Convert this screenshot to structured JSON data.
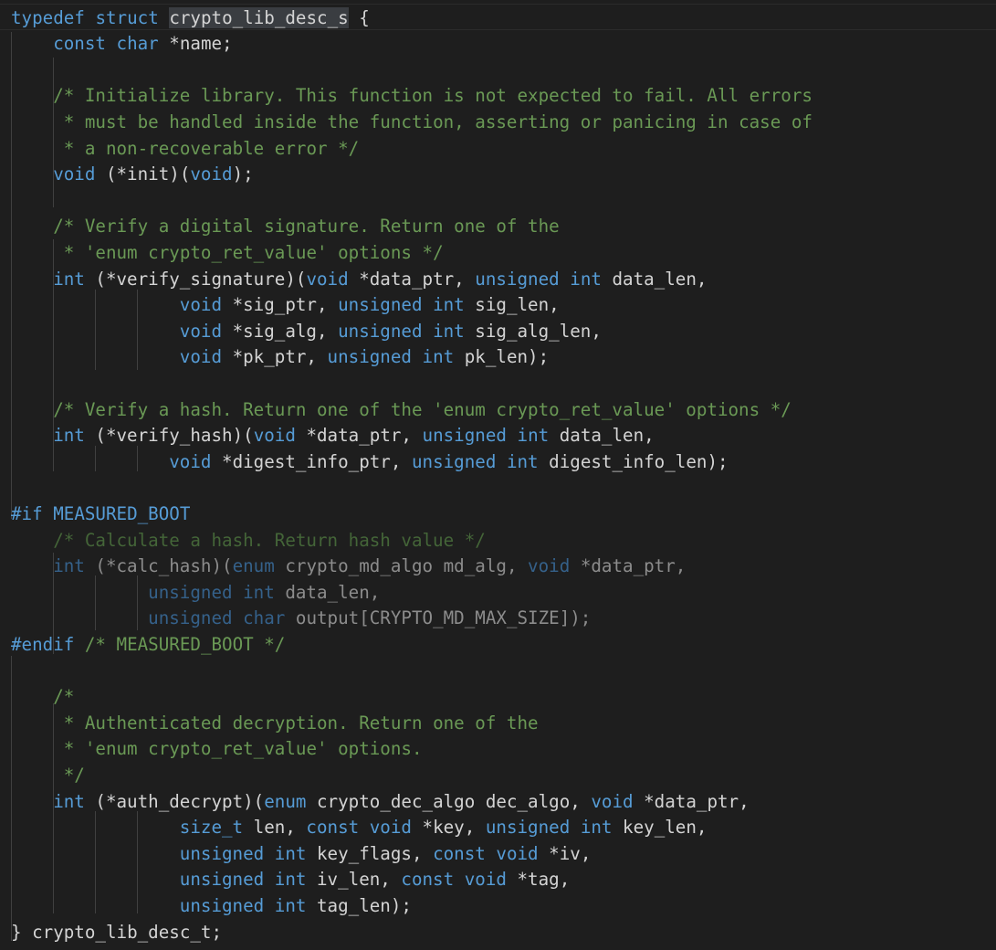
{
  "editor": {
    "colors": {
      "background": "#1e1e1e",
      "keyword": "#569cd6",
      "comment": "#6a9955",
      "text": "#d4d4d4",
      "selection": "#3a3d41",
      "indent_guide": "#404040"
    },
    "lines": [
      {
        "row": 0,
        "indent": 0,
        "dim": false,
        "tokens": [
          [
            "kw",
            "typedef"
          ],
          [
            "tx",
            " "
          ],
          [
            "kw",
            "struct"
          ],
          [
            "tx",
            " "
          ],
          [
            "hl",
            "crypto_lib_desc_s"
          ],
          [
            "tx",
            " {"
          ]
        ]
      },
      {
        "row": 1,
        "indent": 4,
        "dim": false,
        "tokens": [
          [
            "kw",
            "const"
          ],
          [
            "tx",
            " "
          ],
          [
            "kw",
            "char"
          ],
          [
            "tx",
            " *name;"
          ]
        ]
      },
      {
        "row": 3,
        "indent": 4,
        "dim": false,
        "tokens": [
          [
            "cm",
            "/* Initialize library. This function is not expected to fail. All errors"
          ]
        ]
      },
      {
        "row": 4,
        "indent": 5,
        "dim": false,
        "tokens": [
          [
            "cm",
            "* must be handled inside the function, asserting or panicing in case of"
          ]
        ]
      },
      {
        "row": 5,
        "indent": 5,
        "dim": false,
        "tokens": [
          [
            "cm",
            "* a non-recoverable error */"
          ]
        ]
      },
      {
        "row": 6,
        "indent": 4,
        "dim": false,
        "tokens": [
          [
            "kw",
            "void"
          ],
          [
            "tx",
            " (*init)("
          ],
          [
            "kw",
            "void"
          ],
          [
            "tx",
            ");"
          ]
        ]
      },
      {
        "row": 8,
        "indent": 4,
        "dim": false,
        "tokens": [
          [
            "cm",
            "/* Verify a digital signature. Return one of the"
          ]
        ]
      },
      {
        "row": 9,
        "indent": 5,
        "dim": false,
        "tokens": [
          [
            "cm",
            "* 'enum crypto_ret_value' options */"
          ]
        ]
      },
      {
        "row": 10,
        "indent": 4,
        "dim": false,
        "tokens": [
          [
            "kw",
            "int"
          ],
          [
            "tx",
            " (*verify_signature)("
          ],
          [
            "kw",
            "void"
          ],
          [
            "tx",
            " *data_ptr, "
          ],
          [
            "kw",
            "unsigned"
          ],
          [
            "tx",
            " "
          ],
          [
            "kw",
            "int"
          ],
          [
            "tx",
            " data_len,"
          ]
        ]
      },
      {
        "row": 11,
        "indent": 16,
        "dim": false,
        "tokens": [
          [
            "kw",
            "void"
          ],
          [
            "tx",
            " *sig_ptr, "
          ],
          [
            "kw",
            "unsigned"
          ],
          [
            "tx",
            " "
          ],
          [
            "kw",
            "int"
          ],
          [
            "tx",
            " sig_len,"
          ]
        ]
      },
      {
        "row": 12,
        "indent": 16,
        "dim": false,
        "tokens": [
          [
            "kw",
            "void"
          ],
          [
            "tx",
            " *sig_alg, "
          ],
          [
            "kw",
            "unsigned"
          ],
          [
            "tx",
            " "
          ],
          [
            "kw",
            "int"
          ],
          [
            "tx",
            " sig_alg_len,"
          ]
        ]
      },
      {
        "row": 13,
        "indent": 16,
        "dim": false,
        "tokens": [
          [
            "kw",
            "void"
          ],
          [
            "tx",
            " *pk_ptr, "
          ],
          [
            "kw",
            "unsigned"
          ],
          [
            "tx",
            " "
          ],
          [
            "kw",
            "int"
          ],
          [
            "tx",
            " pk_len);"
          ]
        ]
      },
      {
        "row": 15,
        "indent": 4,
        "dim": false,
        "tokens": [
          [
            "cm",
            "/* Verify a hash. Return one of the 'enum crypto_ret_value' options */"
          ]
        ]
      },
      {
        "row": 16,
        "indent": 4,
        "dim": false,
        "tokens": [
          [
            "kw",
            "int"
          ],
          [
            "tx",
            " (*verify_hash)("
          ],
          [
            "kw",
            "void"
          ],
          [
            "tx",
            " *data_ptr, "
          ],
          [
            "kw",
            "unsigned"
          ],
          [
            "tx",
            " "
          ],
          [
            "kw",
            "int"
          ],
          [
            "tx",
            " data_len,"
          ]
        ]
      },
      {
        "row": 17,
        "indent": 15,
        "dim": false,
        "tokens": [
          [
            "kw",
            "void"
          ],
          [
            "tx",
            " *digest_info_ptr, "
          ],
          [
            "kw",
            "unsigned"
          ],
          [
            "tx",
            " "
          ],
          [
            "kw",
            "int"
          ],
          [
            "tx",
            " digest_info_len);"
          ]
        ]
      },
      {
        "row": 19,
        "indent": 0,
        "dim": false,
        "tokens": [
          [
            "kw",
            "#if"
          ],
          [
            "tx",
            " "
          ],
          [
            "kw",
            "MEASURED_BOOT"
          ]
        ]
      },
      {
        "row": 20,
        "indent": 4,
        "dim": true,
        "tokens": [
          [
            "cm",
            "/* Calculate a hash. Return hash value */"
          ]
        ]
      },
      {
        "row": 21,
        "indent": 4,
        "dim": true,
        "tokens": [
          [
            "kw",
            "int"
          ],
          [
            "tx",
            " (*calc_hash)("
          ],
          [
            "kw",
            "enum"
          ],
          [
            "tx",
            " crypto_md_algo md_alg, "
          ],
          [
            "kw",
            "void"
          ],
          [
            "tx",
            " *data_ptr,"
          ]
        ]
      },
      {
        "row": 22,
        "indent": 13,
        "dim": true,
        "tokens": [
          [
            "kw",
            "unsigned"
          ],
          [
            "tx",
            " "
          ],
          [
            "kw",
            "int"
          ],
          [
            "tx",
            " data_len,"
          ]
        ]
      },
      {
        "row": 23,
        "indent": 13,
        "dim": true,
        "tokens": [
          [
            "kw",
            "unsigned"
          ],
          [
            "tx",
            " "
          ],
          [
            "kw",
            "char"
          ],
          [
            "tx",
            " output[CRYPTO_MD_MAX_SIZE]);"
          ]
        ]
      },
      {
        "row": 24,
        "indent": 0,
        "dim": false,
        "tokens": [
          [
            "kw",
            "#endif"
          ],
          [
            "tx",
            " "
          ],
          [
            "cm",
            "/* MEASURED_BOOT */"
          ]
        ]
      },
      {
        "row": 26,
        "indent": 4,
        "dim": false,
        "tokens": [
          [
            "cm",
            "/*"
          ]
        ]
      },
      {
        "row": 27,
        "indent": 5,
        "dim": false,
        "tokens": [
          [
            "cm",
            "* Authenticated decryption. Return one of the"
          ]
        ]
      },
      {
        "row": 28,
        "indent": 5,
        "dim": false,
        "tokens": [
          [
            "cm",
            "* 'enum crypto_ret_value' options."
          ]
        ]
      },
      {
        "row": 29,
        "indent": 5,
        "dim": false,
        "tokens": [
          [
            "cm",
            "*/"
          ]
        ]
      },
      {
        "row": 30,
        "indent": 4,
        "dim": false,
        "tokens": [
          [
            "kw",
            "int"
          ],
          [
            "tx",
            " (*auth_decrypt)("
          ],
          [
            "kw",
            "enum"
          ],
          [
            "tx",
            " crypto_dec_algo dec_algo, "
          ],
          [
            "kw",
            "void"
          ],
          [
            "tx",
            " *data_ptr,"
          ]
        ]
      },
      {
        "row": 31,
        "indent": 16,
        "dim": false,
        "tokens": [
          [
            "kw",
            "size_t"
          ],
          [
            "tx",
            " len, "
          ],
          [
            "kw",
            "const"
          ],
          [
            "tx",
            " "
          ],
          [
            "kw",
            "void"
          ],
          [
            "tx",
            " *key, "
          ],
          [
            "kw",
            "unsigned"
          ],
          [
            "tx",
            " "
          ],
          [
            "kw",
            "int"
          ],
          [
            "tx",
            " key_len,"
          ]
        ]
      },
      {
        "row": 32,
        "indent": 16,
        "dim": false,
        "tokens": [
          [
            "kw",
            "unsigned"
          ],
          [
            "tx",
            " "
          ],
          [
            "kw",
            "int"
          ],
          [
            "tx",
            " key_flags, "
          ],
          [
            "kw",
            "const"
          ],
          [
            "tx",
            " "
          ],
          [
            "kw",
            "void"
          ],
          [
            "tx",
            " *iv,"
          ]
        ]
      },
      {
        "row": 33,
        "indent": 16,
        "dim": false,
        "tokens": [
          [
            "kw",
            "unsigned"
          ],
          [
            "tx",
            " "
          ],
          [
            "kw",
            "int"
          ],
          [
            "tx",
            " iv_len, "
          ],
          [
            "kw",
            "const"
          ],
          [
            "tx",
            " "
          ],
          [
            "kw",
            "void"
          ],
          [
            "tx",
            " *tag,"
          ]
        ]
      },
      {
        "row": 34,
        "indent": 16,
        "dim": false,
        "tokens": [
          [
            "kw",
            "unsigned"
          ],
          [
            "tx",
            " "
          ],
          [
            "kw",
            "int"
          ],
          [
            "tx",
            " tag_len);"
          ]
        ]
      },
      {
        "row": 35,
        "indent": 0,
        "dim": false,
        "tokens": [
          [
            "tx",
            "} crypto_lib_desc_t;"
          ]
        ]
      }
    ]
  }
}
